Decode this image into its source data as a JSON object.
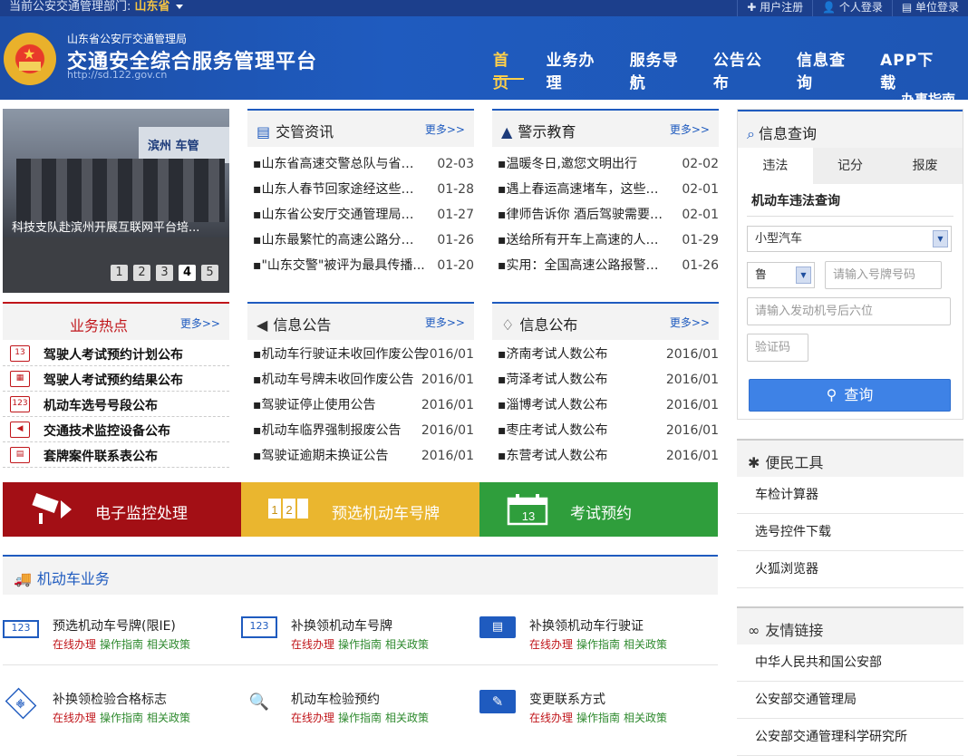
{
  "topbar": {
    "dept_prefix": "当前公安交通管理部门:",
    "dept_value": "山东省",
    "links": [
      "✚ 用户注册",
      "👤 个人登录",
      "▤ 单位登录"
    ]
  },
  "header": {
    "sub": "山东省公安厅交通管理局",
    "title": "交通安全综合服务管理平台",
    "url": "http://sd.122.gov.cn",
    "nav": [
      "首页",
      "业务办理",
      "服务导航",
      "公告公布",
      "信息查询",
      "APP下载"
    ],
    "nav_extra": "办事指南"
  },
  "slider": {
    "caption": "科技支队赴滨州开展互联网平台培...",
    "sign": "滨州 车管",
    "pages": [
      "1",
      "2",
      "3",
      "4",
      "5"
    ],
    "active_page": "4"
  },
  "news": {
    "title": "交管资讯",
    "more": "更多>>",
    "items": [
      {
        "t": "▪山东省高速交警总队与省保...",
        "d": "02-03"
      },
      {
        "t": "▪山东人春节回家途经这些路...",
        "d": "01-28"
      },
      {
        "t": "▪山东省公安厅交通管理局领...",
        "d": "01-27"
      },
      {
        "t": "▪山东最繁忙的高速公路分流...",
        "d": "01-26"
      },
      {
        "t": "▪\"山东交警\"被评为最具传播...",
        "d": "01-20"
      }
    ]
  },
  "warning": {
    "title": "警示教育",
    "more": "更多>>",
    "items": [
      {
        "t": "▪温暖冬日,邀您文明出行",
        "d": "02-02"
      },
      {
        "t": "▪遇上春运高速堵车，这些事...",
        "d": "02-01"
      },
      {
        "t": "▪律师告诉你 酒后驾驶需要承...",
        "d": "02-01"
      },
      {
        "t": "▪送给所有开车上高速的人~...",
        "d": "01-29"
      },
      {
        "t": "▪实用：全国高速公路报警求...",
        "d": "01-26"
      }
    ]
  },
  "hot": {
    "title": "业务热点",
    "more": "更多>>",
    "items": [
      {
        "icon": "13",
        "label": "驾驶人考试预约计划公布"
      },
      {
        "icon": "▦",
        "label": "驾驶人考试预约结果公布"
      },
      {
        "icon": "123",
        "label": "机动车选号号段公布"
      },
      {
        "icon": "◀",
        "label": "交通技术监控设备公布"
      },
      {
        "icon": "▤",
        "label": "套牌案件联系表公布"
      }
    ]
  },
  "notice": {
    "title": "信息公告",
    "more": "更多>>",
    "items": [
      {
        "t": "▪机动车行驶证未收回作废公告",
        "d": "2016/01"
      },
      {
        "t": "▪机动车号牌未收回作废公告",
        "d": "2016/01"
      },
      {
        "t": "▪驾驶证停止使用公告",
        "d": "2016/01"
      },
      {
        "t": "▪机动车临界强制报废公告",
        "d": "2016/01"
      },
      {
        "t": "▪驾驶证逾期未换证公告",
        "d": "2016/01"
      }
    ]
  },
  "publish": {
    "title": "信息公布",
    "more": "更多>>",
    "items": [
      {
        "t": "▪济南考试人数公布",
        "d": "2016/01"
      },
      {
        "t": "▪菏泽考试人数公布",
        "d": "2016/01"
      },
      {
        "t": "▪淄博考试人数公布",
        "d": "2016/01"
      },
      {
        "t": "▪枣庄考试人数公布",
        "d": "2016/01"
      },
      {
        "t": "▪东营考试人数公布",
        "d": "2016/01"
      }
    ]
  },
  "banners": {
    "b1": "电子监控处理",
    "b2": "预选机动车号牌",
    "b3": "考试预约",
    "b2_icon": "1 2",
    "b3_icon": "13"
  },
  "vehicle": {
    "title": "机动车业务",
    "ops": [
      "在线办理",
      "操作指南",
      "相关政策"
    ],
    "services": [
      {
        "name": "预选机动车号牌(限IE)",
        "icon": "123"
      },
      {
        "name": "补换领机动车号牌",
        "icon": "123"
      },
      {
        "name": "补换领机动车行驶证",
        "icon": "▤"
      },
      {
        "name": "补换领检验合格标志",
        "icon": "验"
      },
      {
        "name": "机动车检验预约",
        "icon": "🔍"
      },
      {
        "name": "变更联系方式",
        "icon": "✎"
      }
    ]
  },
  "info": {
    "title": "信息查询",
    "tabs": [
      "违法",
      "记分",
      "报废"
    ],
    "query_title": "机动车违法查询",
    "vehicle_type": "小型汽车",
    "province": "鲁",
    "plate_placeholder": "请输入号牌号码",
    "engine_placeholder": "请输入发动机号后六位",
    "captcha_placeholder": "验证码",
    "query_btn": "查询"
  },
  "tools": {
    "title": "便民工具",
    "items": [
      "车检计算器",
      "选号控件下载",
      "火狐浏览器"
    ]
  },
  "friend_links": {
    "title": "友情链接",
    "items": [
      "中华人民共和国公安部",
      "公安部交通管理局",
      "公安部交通管理科学研究所"
    ]
  },
  "colors": {
    "primary": "#1f5bbf",
    "red": "#a30f15",
    "yellow": "#eab62f",
    "green": "#2f9e3c"
  }
}
